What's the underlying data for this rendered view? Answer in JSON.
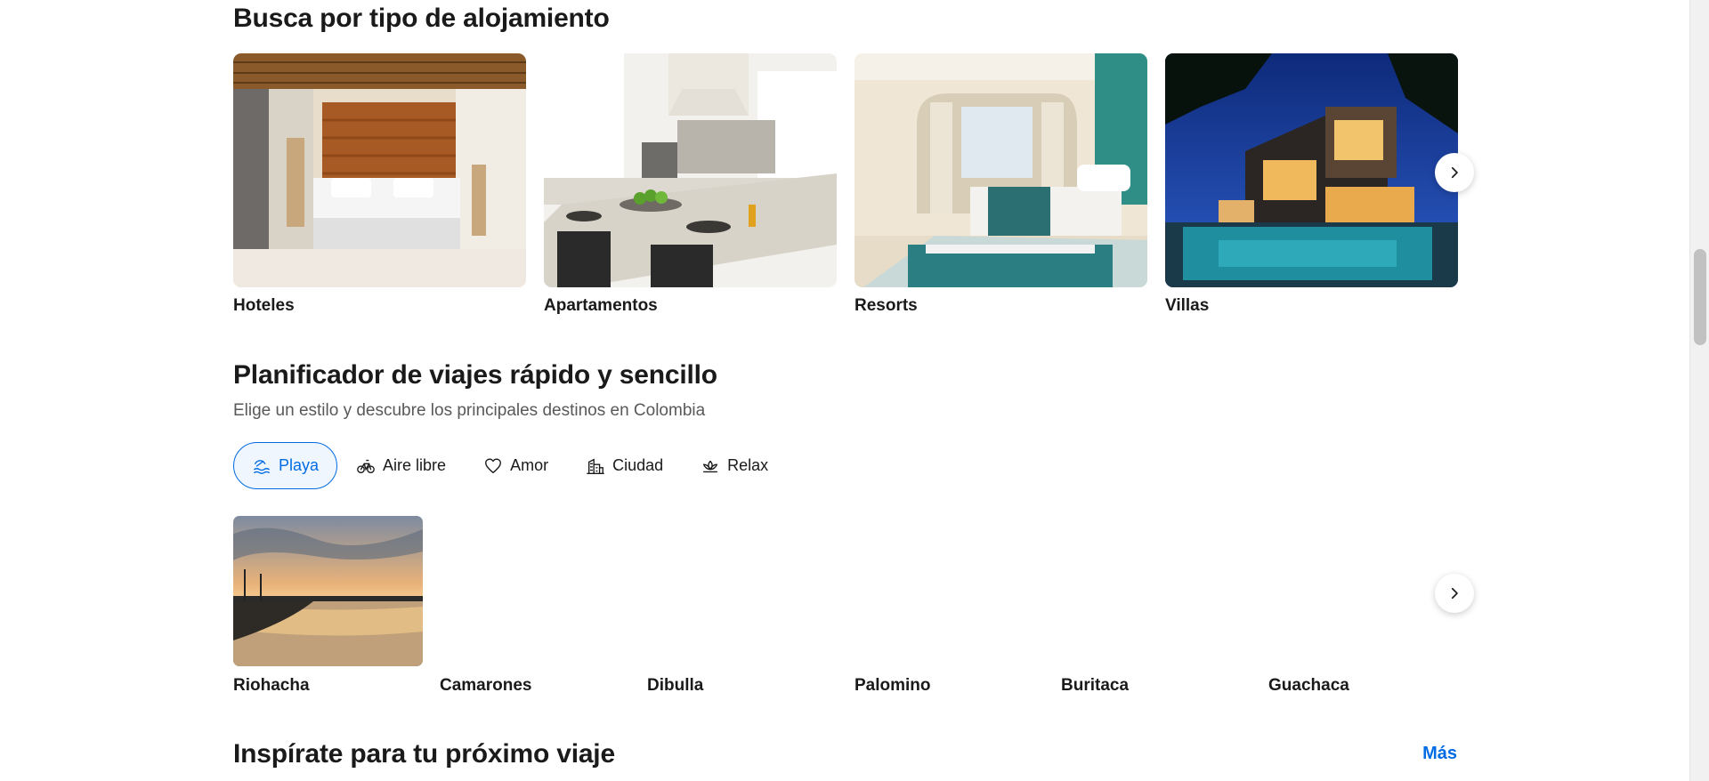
{
  "property_types": {
    "title": "Busca por tipo de alojamiento",
    "items": [
      {
        "label": "Hoteles"
      },
      {
        "label": "Apartamentos"
      },
      {
        "label": "Resorts"
      },
      {
        "label": "Villas"
      }
    ]
  },
  "trip_planner": {
    "title": "Planificador de viajes rápido y sencillo",
    "subtitle": "Elige un estilo y descubre los principales destinos en Colombia",
    "filters": [
      {
        "label": "Playa",
        "icon": "beach-icon",
        "active": true
      },
      {
        "label": "Aire libre",
        "icon": "bicycle-icon",
        "active": false
      },
      {
        "label": "Amor",
        "icon": "heart-icon",
        "active": false
      },
      {
        "label": "Ciudad",
        "icon": "city-icon",
        "active": false
      },
      {
        "label": "Relax",
        "icon": "lotus-icon",
        "active": false
      }
    ],
    "destinations": [
      {
        "label": "Riohacha"
      },
      {
        "label": "Camarones"
      },
      {
        "label": "Dibulla"
      },
      {
        "label": "Palomino"
      },
      {
        "label": "Buritaca"
      },
      {
        "label": "Guachaca"
      }
    ]
  },
  "inspiration": {
    "title": "Inspírate para tu próximo viaje",
    "more_label": "Más"
  },
  "colors": {
    "accent": "#006ce4",
    "text": "#1a1a1a",
    "muted": "#595959"
  }
}
